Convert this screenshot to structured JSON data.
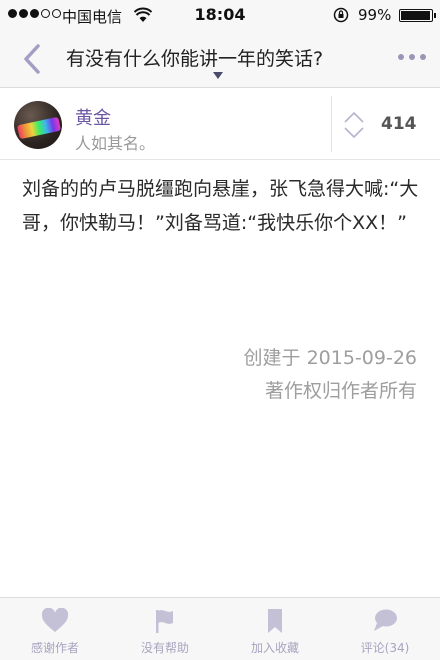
{
  "status_bar": {
    "carrier": "中国电信",
    "time": "18:04",
    "battery": "99%"
  },
  "nav": {
    "title": "有没有什么你能讲一年的笑话?"
  },
  "author": {
    "name": "黄金",
    "bio": "人如其名。",
    "votes": "414"
  },
  "answer": {
    "text": "刘备的的卢马脱缰跑向悬崖，张飞急得大喊:“大哥，你快勒马！”刘备骂道:“我快乐你个XX！”",
    "created": "创建于 2015-09-26",
    "copyright": "著作权归作者所有"
  },
  "tabs": [
    {
      "label": "感谢作者",
      "icon": "heart-icon"
    },
    {
      "label": "没有帮助",
      "icon": "flag-icon"
    },
    {
      "label": "加入收藏",
      "icon": "bookmark-icon"
    },
    {
      "label": "评论(34)",
      "icon": "comment-icon"
    }
  ],
  "colors": {
    "accent": "#6a56a5",
    "icon": "#c4c0d6",
    "muted": "#9e9e9e"
  }
}
